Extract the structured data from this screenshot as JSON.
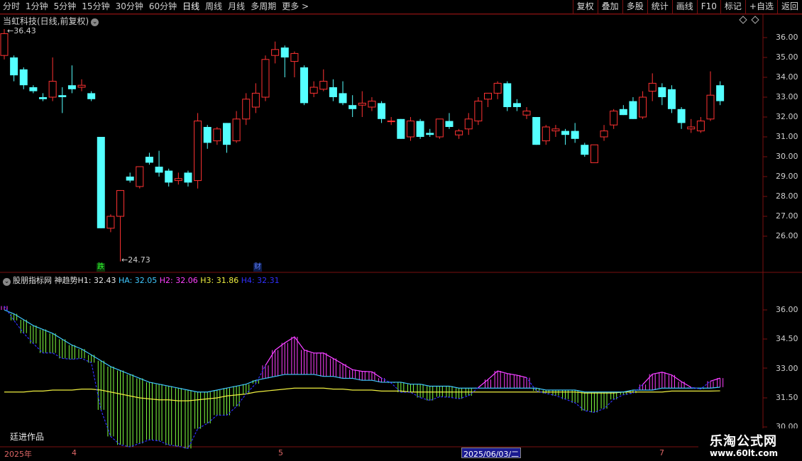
{
  "toolbar": {
    "left": [
      "分时",
      "1分钟",
      "5分钟",
      "15分钟",
      "30分钟",
      "60分钟",
      "日线",
      "周线",
      "月线",
      "多周期",
      "更多 >"
    ],
    "active_index": 6,
    "right": [
      "复权",
      "叠加",
      "多股",
      "统计",
      "画线",
      "F10",
      "标记",
      "+自选",
      "返回"
    ]
  },
  "panel": {
    "title": "当虹科技(日线,前复权)",
    "high_label": "36.43",
    "low_label": "24.73",
    "y_ticks": [
      "36.00",
      "35.00",
      "34.00",
      "33.00",
      "32.00",
      "31.00",
      "30.00",
      "29.00",
      "28.00",
      "27.00",
      "26.00"
    ],
    "markers": [
      {
        "text": "跌",
        "color": "#00c000"
      },
      {
        "text": "财",
        "color": "#3060ff"
      }
    ]
  },
  "indicator": {
    "name": "股朋指标网 神趋势",
    "values": [
      {
        "label": "H1: 32.43",
        "color": "#e8e8e8"
      },
      {
        "label": "HA: 32.05",
        "color": "#40c8ff"
      },
      {
        "label": "H2: 32.06",
        "color": "#ff40ff"
      },
      {
        "label": "H3: 31.86",
        "color": "#f0f040"
      },
      {
        "label": "H4: 32.31",
        "color": "#3030ff"
      }
    ],
    "y_ticks": [
      "36.00",
      "34.50",
      "33.00",
      "31.50",
      "30.00"
    ],
    "author": "廷进作品"
  },
  "date_axis": {
    "labels": [
      "2025年",
      "4",
      "5",
      "7"
    ],
    "highlight": "2025/06/03/二"
  },
  "watermark": {
    "line1": "乐淘公式网",
    "line2": "www.60lt.com"
  },
  "chart_data": {
    "type": "candlestick",
    "title": "当虹科技(日线,前复权)",
    "ylim": [
      24.7,
      36.5
    ],
    "up_color": "#ff3232",
    "down_color": "#54ffff",
    "candles": [
      {
        "o": 35.1,
        "h": 36.43,
        "l": 34.9,
        "c": 36.2
      },
      {
        "o": 35.0,
        "h": 35.1,
        "l": 33.8,
        "c": 34.1
      },
      {
        "o": 34.4,
        "h": 34.5,
        "l": 33.4,
        "c": 33.6
      },
      {
        "o": 33.5,
        "h": 33.6,
        "l": 33.2,
        "c": 33.3
      },
      {
        "o": 33.0,
        "h": 33.2,
        "l": 32.8,
        "c": 32.9
      },
      {
        "o": 33.0,
        "h": 35.0,
        "l": 32.8,
        "c": 33.8
      },
      {
        "o": 33.1,
        "h": 33.5,
        "l": 32.2,
        "c": 33.0
      },
      {
        "o": 33.6,
        "h": 34.6,
        "l": 33.2,
        "c": 33.4
      },
      {
        "o": 33.5,
        "h": 33.9,
        "l": 33.3,
        "c": 33.6
      },
      {
        "o": 33.2,
        "h": 33.3,
        "l": 32.8,
        "c": 32.9
      },
      {
        "o": 31.0,
        "h": 31.0,
        "l": 26.4,
        "c": 26.4
      },
      {
        "o": 26.4,
        "h": 27.1,
        "l": 26.2,
        "c": 27.0
      },
      {
        "o": 27.0,
        "h": 28.3,
        "l": 24.73,
        "c": 28.3
      },
      {
        "o": 29.0,
        "h": 29.2,
        "l": 28.7,
        "c": 28.8
      },
      {
        "o": 28.5,
        "h": 29.5,
        "l": 28.4,
        "c": 29.5
      },
      {
        "o": 30.0,
        "h": 30.2,
        "l": 29.6,
        "c": 29.7
      },
      {
        "o": 29.5,
        "h": 30.3,
        "l": 29.0,
        "c": 29.2
      },
      {
        "o": 29.3,
        "h": 29.4,
        "l": 28.5,
        "c": 28.7
      },
      {
        "o": 28.8,
        "h": 29.2,
        "l": 28.6,
        "c": 28.9
      },
      {
        "o": 29.2,
        "h": 29.3,
        "l": 28.5,
        "c": 28.7
      },
      {
        "o": 28.8,
        "h": 32.2,
        "l": 28.4,
        "c": 31.8
      },
      {
        "o": 31.5,
        "h": 31.6,
        "l": 30.4,
        "c": 30.7
      },
      {
        "o": 30.8,
        "h": 31.5,
        "l": 30.6,
        "c": 31.4
      },
      {
        "o": 31.7,
        "h": 31.7,
        "l": 30.2,
        "c": 30.6
      },
      {
        "o": 30.8,
        "h": 32.3,
        "l": 30.7,
        "c": 31.9
      },
      {
        "o": 31.9,
        "h": 33.2,
        "l": 31.6,
        "c": 32.9
      },
      {
        "o": 32.5,
        "h": 33.7,
        "l": 32.2,
        "c": 33.2
      },
      {
        "o": 33.0,
        "h": 35.1,
        "l": 32.8,
        "c": 34.9
      },
      {
        "o": 35.1,
        "h": 35.8,
        "l": 34.7,
        "c": 35.4
      },
      {
        "o": 35.5,
        "h": 35.6,
        "l": 34.0,
        "c": 35.0
      },
      {
        "o": 34.8,
        "h": 35.3,
        "l": 34.0,
        "c": 35.2
      },
      {
        "o": 34.5,
        "h": 34.6,
        "l": 32.6,
        "c": 32.7
      },
      {
        "o": 33.2,
        "h": 33.8,
        "l": 33.0,
        "c": 33.5
      },
      {
        "o": 33.4,
        "h": 34.4,
        "l": 33.3,
        "c": 33.8
      },
      {
        "o": 33.5,
        "h": 33.9,
        "l": 32.8,
        "c": 33.0
      },
      {
        "o": 33.2,
        "h": 33.8,
        "l": 32.6,
        "c": 32.7
      },
      {
        "o": 32.6,
        "h": 33.1,
        "l": 32.0,
        "c": 32.4
      },
      {
        "o": 32.6,
        "h": 33.3,
        "l": 32.0,
        "c": 32.7
      },
      {
        "o": 32.5,
        "h": 33.0,
        "l": 32.3,
        "c": 32.8
      },
      {
        "o": 32.7,
        "h": 32.8,
        "l": 31.7,
        "c": 31.9
      },
      {
        "o": 31.8,
        "h": 32.0,
        "l": 31.6,
        "c": 31.8
      },
      {
        "o": 31.9,
        "h": 31.9,
        "l": 30.9,
        "c": 30.9
      },
      {
        "o": 31.0,
        "h": 32.0,
        "l": 30.8,
        "c": 31.8
      },
      {
        "o": 31.8,
        "h": 31.9,
        "l": 30.9,
        "c": 31.0
      },
      {
        "o": 31.2,
        "h": 31.4,
        "l": 31.0,
        "c": 31.1
      },
      {
        "o": 31.0,
        "h": 31.9,
        "l": 30.9,
        "c": 31.9
      },
      {
        "o": 31.8,
        "h": 32.2,
        "l": 31.4,
        "c": 31.5
      },
      {
        "o": 31.1,
        "h": 31.4,
        "l": 30.9,
        "c": 31.3
      },
      {
        "o": 31.4,
        "h": 32.2,
        "l": 31.1,
        "c": 31.9
      },
      {
        "o": 31.8,
        "h": 33.0,
        "l": 31.6,
        "c": 32.8
      },
      {
        "o": 32.9,
        "h": 33.2,
        "l": 32.5,
        "c": 33.2
      },
      {
        "o": 33.2,
        "h": 33.8,
        "l": 32.9,
        "c": 33.7
      },
      {
        "o": 33.7,
        "h": 33.8,
        "l": 32.3,
        "c": 32.5
      },
      {
        "o": 32.7,
        "h": 32.9,
        "l": 32.3,
        "c": 32.5
      },
      {
        "o": 32.1,
        "h": 32.5,
        "l": 31.9,
        "c": 32.3
      },
      {
        "o": 32.0,
        "h": 32.0,
        "l": 30.6,
        "c": 30.6
      },
      {
        "o": 30.8,
        "h": 31.6,
        "l": 30.6,
        "c": 31.5
      },
      {
        "o": 31.3,
        "h": 31.6,
        "l": 31.0,
        "c": 31.4
      },
      {
        "o": 31.3,
        "h": 31.4,
        "l": 30.6,
        "c": 31.1
      },
      {
        "o": 31.3,
        "h": 31.7,
        "l": 30.7,
        "c": 30.9
      },
      {
        "o": 30.6,
        "h": 30.7,
        "l": 30.0,
        "c": 30.1
      },
      {
        "o": 29.7,
        "h": 30.6,
        "l": 29.7,
        "c": 30.6
      },
      {
        "o": 31.0,
        "h": 31.6,
        "l": 30.8,
        "c": 31.3
      },
      {
        "o": 31.6,
        "h": 32.4,
        "l": 31.4,
        "c": 32.3
      },
      {
        "o": 32.4,
        "h": 32.6,
        "l": 32.1,
        "c": 32.1
      },
      {
        "o": 32.8,
        "h": 33.0,
        "l": 31.9,
        "c": 31.9
      },
      {
        "o": 32.0,
        "h": 33.3,
        "l": 31.9,
        "c": 33.0
      },
      {
        "o": 33.3,
        "h": 34.2,
        "l": 32.8,
        "c": 33.7
      },
      {
        "o": 33.5,
        "h": 33.7,
        "l": 32.6,
        "c": 33.0
      },
      {
        "o": 33.4,
        "h": 33.6,
        "l": 32.2,
        "c": 32.4
      },
      {
        "o": 32.4,
        "h": 32.5,
        "l": 31.4,
        "c": 31.7
      },
      {
        "o": 31.4,
        "h": 31.9,
        "l": 31.2,
        "c": 31.5
      },
      {
        "o": 31.3,
        "h": 32.0,
        "l": 31.2,
        "c": 31.8
      },
      {
        "o": 31.9,
        "h": 34.3,
        "l": 31.8,
        "c": 33.1
      },
      {
        "o": 33.6,
        "h": 33.8,
        "l": 32.6,
        "c": 32.8
      }
    ],
    "indicator_ylim": [
      29.4,
      37.6
    ],
    "indicator_series": [
      {
        "name": "HA",
        "color": "#40c8ff",
        "values": [
          36.0,
          35.8,
          35.5,
          35.2,
          35.0,
          34.8,
          34.5,
          34.2,
          34.0,
          33.7,
          33.4,
          33.1,
          32.9,
          32.7,
          32.5,
          32.3,
          32.2,
          32.1,
          32.0,
          31.9,
          31.8,
          31.8,
          31.9,
          32.0,
          32.1,
          32.2,
          32.4,
          32.5,
          32.6,
          32.7,
          32.7,
          32.7,
          32.7,
          32.6,
          32.6,
          32.5,
          32.5,
          32.4,
          32.4,
          32.3,
          32.3,
          32.3,
          32.2,
          32.2,
          32.1,
          32.1,
          32.1,
          32.0,
          32.0,
          32.0,
          32.0,
          32.0,
          32.0,
          32.0,
          32.0,
          32.0,
          31.9,
          31.9,
          31.9,
          31.9,
          31.8,
          31.8,
          31.8,
          31.8,
          31.8,
          31.9,
          31.9,
          31.9,
          32.0,
          32.0,
          32.0,
          32.0,
          32.0,
          32.0,
          32.05
        ]
      },
      {
        "name": "H3",
        "color": "#f0f040",
        "values": [
          31.8,
          31.8,
          31.8,
          31.85,
          31.85,
          31.9,
          31.9,
          31.9,
          31.95,
          31.95,
          31.9,
          31.8,
          31.7,
          31.6,
          31.5,
          31.45,
          31.4,
          31.4,
          31.35,
          31.35,
          31.4,
          31.45,
          31.5,
          31.6,
          31.65,
          31.7,
          31.8,
          31.85,
          31.9,
          31.95,
          32.0,
          32.0,
          32.0,
          32.0,
          31.95,
          31.95,
          31.9,
          31.9,
          31.9,
          31.85,
          31.85,
          31.85,
          31.8,
          31.8,
          31.8,
          31.8,
          31.8,
          31.8,
          31.8,
          31.8,
          31.8,
          31.8,
          31.8,
          31.8,
          31.8,
          31.8,
          31.8,
          31.8,
          31.8,
          31.8,
          31.75,
          31.75,
          31.75,
          31.75,
          31.8,
          31.8,
          31.8,
          31.8,
          31.8,
          31.85,
          31.85,
          31.85,
          31.85,
          31.85,
          31.86
        ]
      }
    ]
  }
}
